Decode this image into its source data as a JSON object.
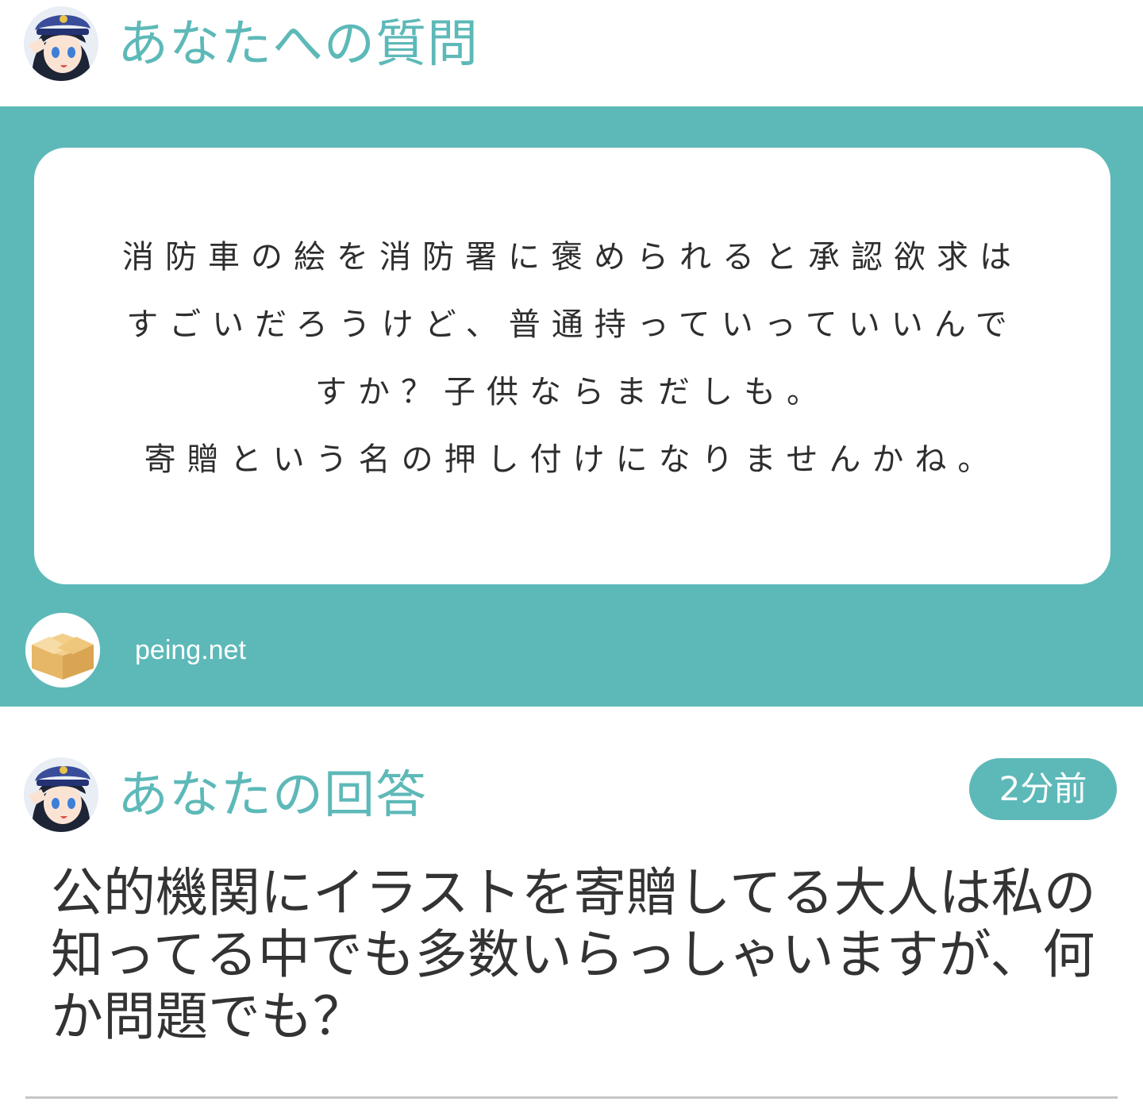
{
  "question_section": {
    "title": "あなたへの質問",
    "avatar_icon": "police-girl-avatar-icon"
  },
  "question_card": {
    "lines": [
      "消防車の絵を消防署に褒められると承認欲求は",
      "すごいだろうけど、普通持っていっていいんで",
      "すか？子供ならまだしも。",
      "寄贈という名の押し付けになりませんかね。"
    ],
    "source_label": "peing.net",
    "source_icon": "cardboard-box-icon"
  },
  "answer_section": {
    "title": "あなたの回答",
    "avatar_icon": "police-girl-avatar-icon",
    "timestamp": "2分前",
    "lines": [
      "公的機関にイラストを寄贈してる大人は私の",
      "知ってる中でも多数いらっしゃいますが、何",
      "か問題でも？"
    ]
  },
  "colors": {
    "accent": "#5db9b8",
    "card_background": "#ffffff",
    "text": "#333333",
    "divider": "#c6c6c6"
  }
}
